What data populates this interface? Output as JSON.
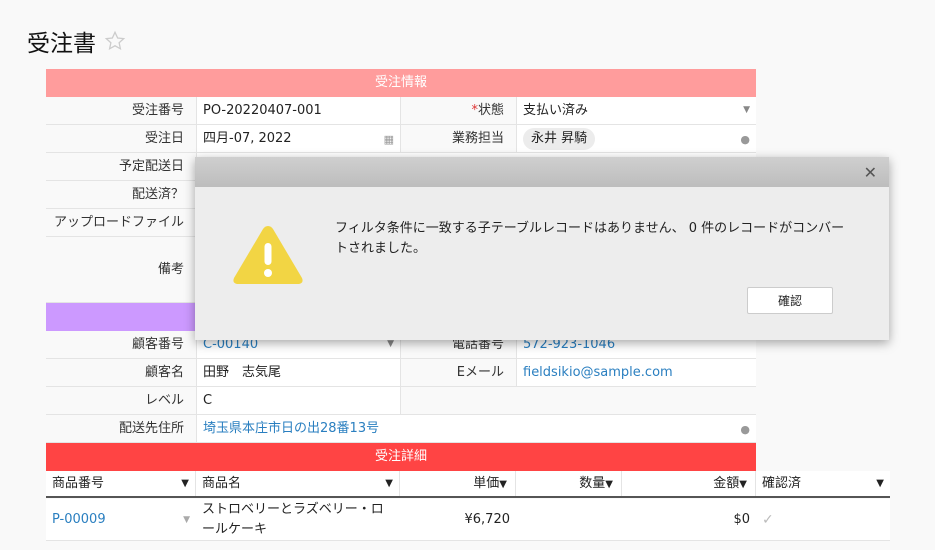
{
  "page": {
    "title": "受注書"
  },
  "colors": {
    "order_info": "#ff9c9c",
    "customer_info": "#cc99ff",
    "order_detail": "#ff4444",
    "link": "#2a7fc0",
    "warning": "#f2d544"
  },
  "order_info": {
    "header": "受注情報",
    "order_no_label": "受注番号",
    "order_no": "PO-20220407-001",
    "status_label": "状態",
    "status_required": "*",
    "status": "支払い済み",
    "order_date_label": "受注日",
    "order_date": "四月-07, 2022",
    "staff_label": "業務担当",
    "staff": "永井 昇騎",
    "planned_ship_label": "予定配送日",
    "shipped_label": "配送済？",
    "upload_label": "アップロードファイル",
    "notes_label": "備考"
  },
  "customer_info": {
    "customer_no_label": "顧客番号",
    "customer_no": "C-00140",
    "phone_label": "電話番号",
    "phone": "572-923-1046",
    "customer_name_label": "顧客名",
    "customer_name": "田野　志気尾",
    "email_label": "Eメール",
    "email": "fieldsikio@sample.com",
    "level_label": "レベル",
    "level": "C",
    "address_label": "配送先住所",
    "address": "埼玉県本庄市日の出28番13号"
  },
  "order_detail": {
    "header": "受注詳細",
    "columns": [
      "商品番号",
      "商品名",
      "単価",
      "数量",
      "金額",
      "確認済"
    ],
    "rows": [
      {
        "product_no": "P-00009",
        "product_name": "ストロベリーとラズベリー・ロールケーキ",
        "unit_price": "¥6,720",
        "quantity": "",
        "amount": "$0"
      }
    ]
  },
  "dialog": {
    "message": "フィルタ条件に一致する子テーブルレコードはありません、 0 件のレコードがコンバートされました。",
    "ok_label": "確認"
  }
}
